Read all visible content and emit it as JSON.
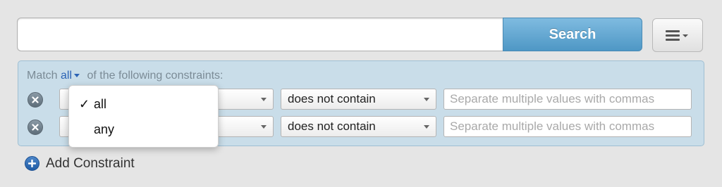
{
  "search": {
    "value": "",
    "placeholder": "",
    "button_label": "Search"
  },
  "menu": {
    "icon": "hamburger-menu-icon"
  },
  "constraints": {
    "match_prefix": "Match",
    "match_value": "all",
    "match_suffix": "of the following constraints:",
    "rows": [
      {
        "field": "",
        "operator": "does not contain",
        "value": "",
        "placeholder": "Separate multiple values with commas"
      },
      {
        "field": "",
        "operator": "does not contain",
        "value": "",
        "placeholder": "Separate multiple values with commas"
      }
    ],
    "add_label": "Add Constraint"
  },
  "match_dropdown": {
    "options": [
      {
        "label": "all",
        "selected": true,
        "check": "✓"
      },
      {
        "label": "any",
        "selected": false,
        "check": ""
      }
    ]
  },
  "colors": {
    "accent": "#4e97c5",
    "panel": "#c9dde9",
    "link": "#2b63b5"
  }
}
